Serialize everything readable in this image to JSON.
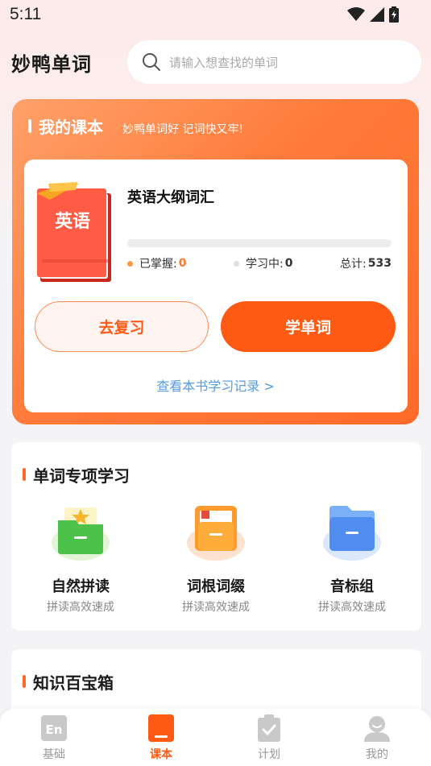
{
  "status_bar": {
    "time": "5:11"
  },
  "header": {
    "app_title": "妙鸭单词",
    "search_placeholder": "请输入想查找的单词"
  },
  "course": {
    "section_title": "我的课本",
    "section_subtitle": "妙鸭单词好 记词快又牢!",
    "book_cover_text": "英语",
    "book_name": "英语大纲词汇",
    "progress_fraction": 0,
    "mastered_label": "已掌握:",
    "mastered_value": "0",
    "learning_label": "学习中:",
    "learning_value": "0",
    "total_label": "总计:",
    "total_value": "533",
    "review_button": "去复习",
    "learn_button": "学单词",
    "record_link": "查看本书学习记录 >"
  },
  "special": {
    "title": "单词专项学习",
    "items": [
      {
        "name": "自然拼读",
        "desc": "拼读高效速成",
        "icon": "green-folder-star-icon"
      },
      {
        "name": "词根词缀",
        "desc": "拼读高效速成",
        "icon": "orange-folder-icon"
      },
      {
        "name": "音标组",
        "desc": "拼读高效速成",
        "icon": "blue-folder-icon"
      }
    ]
  },
  "knowledge": {
    "title": "知识百宝箱"
  },
  "nav": {
    "items": [
      {
        "label": "基础",
        "icon": "en-icon"
      },
      {
        "label": "课本",
        "icon": "book-icon"
      },
      {
        "label": "计划",
        "icon": "clipboard-check-icon"
      },
      {
        "label": "我的",
        "icon": "user-icon"
      }
    ],
    "active": "课本"
  },
  "colors": {
    "accent": "#ff5a14",
    "link": "#5a9be0",
    "mastered_dot": "#ff9a3c",
    "learning_dot": "#e0e0e0"
  }
}
